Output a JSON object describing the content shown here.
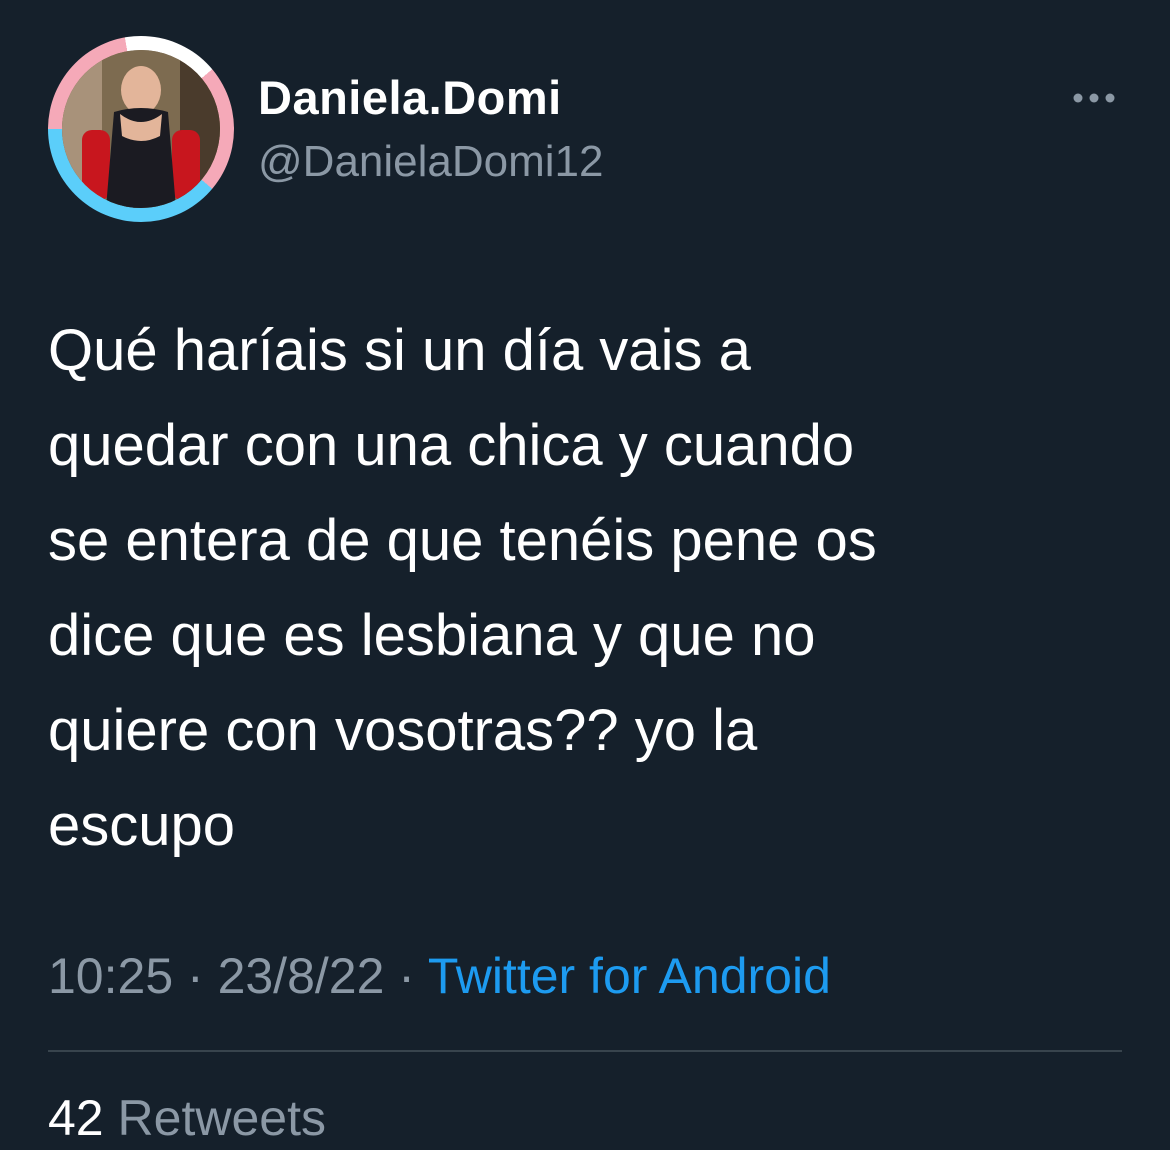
{
  "colors": {
    "background": "#15202b",
    "primary_text": "#ffffff",
    "secondary_text": "#8b98a5",
    "link": "#1d9bf0",
    "divider": "#38444d",
    "avatar_ring_blue": "#5bcefa",
    "avatar_ring_pink": "#f5a9b8"
  },
  "author": {
    "display_name": "Daniela.Domi",
    "handle": "@DanielaDomi12",
    "avatar_icon": "profile-photo"
  },
  "more_icon": "more-horizontal-icon",
  "tweet": {
    "text": "Qué haríais si un día vais a\nquedar con una chica y cuando\nse entera de que tenéis pene os\ndice que es lesbiana y que no\nquiere con vosotras?? yo la\nescupo"
  },
  "meta": {
    "time": "10:25",
    "sep1": " · ",
    "date": "23/8/22",
    "sep2": " · ",
    "source": "Twitter for Android"
  },
  "stats": {
    "retweets_count": "42",
    "retweets_label": "Retweets"
  }
}
